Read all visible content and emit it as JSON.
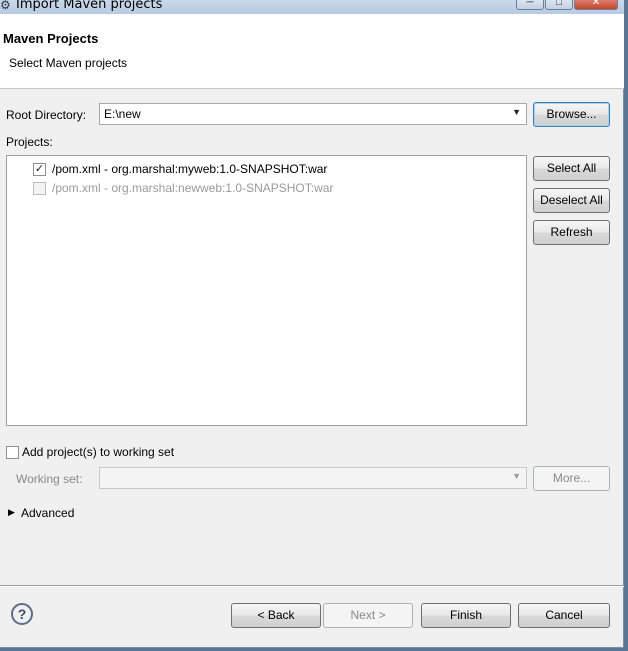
{
  "window": {
    "title": "Import Maven projects",
    "controls": {
      "minimize": "─",
      "maximize": "□",
      "close": "✕"
    }
  },
  "header": {
    "title": "Maven Projects",
    "description": "Select Maven projects"
  },
  "root_directory": {
    "label": "Root Directory:",
    "value": "E:\\new",
    "browse_label": "Browse..."
  },
  "projects": {
    "label": "Projects:",
    "items": [
      {
        "text": "/pom.xml - org.marshal:myweb:1.0-SNAPSHOT:war",
        "checked": true,
        "enabled": true
      },
      {
        "text": "/pom.xml - org.marshal:newweb:1.0-SNAPSHOT:war",
        "checked": false,
        "enabled": false
      }
    ],
    "select_all_label": "Select All",
    "deselect_all_label": "Deselect All",
    "refresh_label": "Refresh"
  },
  "working_set": {
    "add_label": "Add project(s) to working set",
    "label": "Working set:",
    "value": "",
    "more_label": "More..."
  },
  "advanced": {
    "label": "Advanced"
  },
  "footer": {
    "help_icon": "?",
    "back_label": "< Back",
    "next_label": "Next >",
    "finish_label": "Finish",
    "cancel_label": "Cancel"
  },
  "icons": {
    "window_icon": "maven-icon",
    "dropdown": "chevron-down-icon",
    "expand": "triangle-right-icon",
    "help": "help-icon"
  }
}
